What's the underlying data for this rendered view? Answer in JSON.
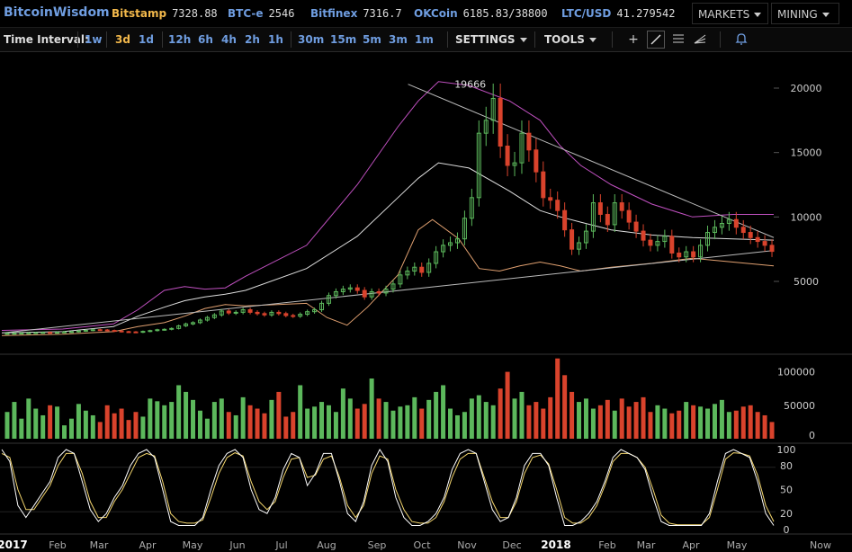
{
  "app": {
    "brand": "BitcoinWisdom"
  },
  "ticker": [
    {
      "exchange": "Bitstamp",
      "price": "7328.88",
      "selected": true
    },
    {
      "exchange": "BTC-e",
      "price": "2546",
      "selected": false
    },
    {
      "exchange": "Bitfinex",
      "price": "7316.7",
      "selected": false
    },
    {
      "exchange": "OKCoin",
      "price": "6185.83/38800",
      "selected": false
    },
    {
      "exchange": "LTC/USD",
      "price": "41.279542",
      "selected": false
    }
  ],
  "menus": {
    "markets": "MARKETS",
    "mining": "MINING"
  },
  "toolbar": {
    "time_interval_label": "Time Interval:",
    "intervals": [
      {
        "label": "1w",
        "selected": false
      },
      {
        "label": "3d",
        "selected": true
      },
      {
        "label": "1d",
        "selected": false
      },
      {
        "label": "12h",
        "selected": false
      },
      {
        "label": "6h",
        "selected": false
      },
      {
        "label": "4h",
        "selected": false
      },
      {
        "label": "2h",
        "selected": false
      },
      {
        "label": "1h",
        "selected": false
      },
      {
        "label": "30m",
        "selected": false
      },
      {
        "label": "15m",
        "selected": false
      },
      {
        "label": "5m",
        "selected": false
      },
      {
        "label": "3m",
        "selected": false
      },
      {
        "label": "1m",
        "selected": false
      }
    ],
    "settings": "SETTINGS",
    "tools": "TOOLS",
    "tool_icons": [
      "crosshair-icon",
      "trendline-icon",
      "horizontal-lines-icon",
      "fan-icon",
      "bell-icon"
    ]
  },
  "colors": {
    "up": "#5cb85c",
    "down": "#d9432c",
    "accent": "#6f9de0",
    "selected": "#f2b84b",
    "upper_band": "#c050c0",
    "lower_band": "#e0a070",
    "mid_band": "#dddddd"
  },
  "chart_data": {
    "type": "candlestick",
    "interval": "3d",
    "price_axis_ticks": [
      "20000",
      "15000",
      "10000",
      "5000"
    ],
    "volume_axis_ticks": [
      "100000",
      "50000",
      "0"
    ],
    "stoch_axis_ticks": [
      "100",
      "80",
      "50",
      "20",
      "0"
    ],
    "time_axis_labels": [
      "2017",
      "Feb",
      "Mar",
      "Apr",
      "May",
      "Jun",
      "Jul",
      "Aug",
      "Sep",
      "Oct",
      "Nov",
      "Dec",
      "2018",
      "Feb",
      "Mar",
      "Apr",
      "May",
      "Now"
    ],
    "peak_label": "19666",
    "close_series": [
      965,
      975,
      990,
      1000,
      1020,
      1040,
      1030,
      1050,
      1080,
      1100,
      1150,
      1200,
      1250,
      1230,
      1190,
      1150,
      1100,
      1080,
      1050,
      1120,
      1180,
      1250,
      1280,
      1350,
      1550,
      1700,
      1800,
      2000,
      2200,
      2400,
      2700,
      2550,
      2600,
      2800,
      2600,
      2500,
      2400,
      2600,
      2500,
      2350,
      2300,
      2450,
      2650,
      2800,
      3300,
      3900,
      4200,
      4400,
      4500,
      4300,
      3800,
      4200,
      4100,
      4400,
      4800,
      5500,
      5800,
      6100,
      5700,
      6400,
      7300,
      7800,
      8000,
      8300,
      9900,
      11500,
      16500,
      17500,
      19200,
      15500,
      14000,
      14200,
      16500,
      15200,
      13500,
      11500,
      11300,
      10500,
      9000,
      7500,
      8000,
      8900,
      11100,
      10200,
      9400,
      11100,
      10500,
      9600,
      8900,
      8200,
      7800,
      8100,
      8500,
      7200,
      6900,
      7300,
      6900,
      7800,
      8800,
      9200,
      9500,
      9800,
      9200,
      8800,
      8400,
      8100,
      7800,
      7330
    ],
    "upper_band_points": [
      [
        0,
        1200
      ],
      [
        30,
        1300
      ],
      [
        55,
        1700
      ],
      [
        67,
        2800
      ],
      [
        80,
        4300
      ],
      [
        90,
        4600
      ],
      [
        100,
        4400
      ],
      [
        110,
        4500
      ],
      [
        120,
        5400
      ],
      [
        150,
        7800
      ],
      [
        175,
        12500
      ],
      [
        195,
        17000
      ],
      [
        205,
        19000
      ],
      [
        215,
        20500
      ],
      [
        230,
        20200
      ],
      [
        250,
        19000
      ],
      [
        265,
        17500
      ],
      [
        275,
        15500
      ],
      [
        285,
        14000
      ],
      [
        300,
        12500
      ],
      [
        320,
        11000
      ],
      [
        340,
        10000
      ],
      [
        360,
        10200
      ],
      [
        380,
        10200
      ]
    ],
    "mid_band_points": [
      [
        0,
        1000
      ],
      [
        30,
        1100
      ],
      [
        55,
        1500
      ],
      [
        67,
        2300
      ],
      [
        80,
        3000
      ],
      [
        90,
        3500
      ],
      [
        100,
        3800
      ],
      [
        110,
        4000
      ],
      [
        120,
        4300
      ],
      [
        150,
        6000
      ],
      [
        175,
        8500
      ],
      [
        195,
        11500
      ],
      [
        205,
        13000
      ],
      [
        215,
        14200
      ],
      [
        230,
        13800
      ],
      [
        250,
        12000
      ],
      [
        265,
        10500
      ],
      [
        275,
        10000
      ],
      [
        285,
        9600
      ],
      [
        300,
        9000
      ],
      [
        320,
        8600
      ],
      [
        340,
        8400
      ],
      [
        360,
        8300
      ],
      [
        380,
        8200
      ]
    ],
    "lower_band_points": [
      [
        0,
        800
      ],
      [
        30,
        900
      ],
      [
        55,
        1100
      ],
      [
        67,
        1500
      ],
      [
        80,
        1800
      ],
      [
        90,
        2300
      ],
      [
        100,
        2900
      ],
      [
        110,
        3200
      ],
      [
        120,
        3100
      ],
      [
        150,
        3300
      ],
      [
        160,
        2200
      ],
      [
        170,
        1600
      ],
      [
        180,
        3000
      ],
      [
        195,
        5500
      ],
      [
        205,
        9000
      ],
      [
        212,
        9800
      ],
      [
        225,
        8300
      ],
      [
        235,
        6000
      ],
      [
        245,
        5800
      ],
      [
        255,
        6200
      ],
      [
        265,
        6500
      ],
      [
        275,
        6200
      ],
      [
        285,
        5800
      ],
      [
        300,
        6100
      ],
      [
        320,
        6400
      ],
      [
        340,
        6800
      ],
      [
        360,
        6500
      ],
      [
        380,
        6200
      ]
    ],
    "trend_lines": [
      {
        "from": [
          0,
          1000
        ],
        "to": [
          380,
          7400
        ]
      },
      {
        "from": [
          200,
          20300
        ],
        "to": [
          380,
          8400
        ]
      }
    ],
    "volume_series": [
      40000,
      55000,
      30000,
      60000,
      45000,
      35000,
      50000,
      48000,
      20000,
      30000,
      52000,
      42000,
      35000,
      25000,
      50000,
      38000,
      45000,
      28000,
      40000,
      33000,
      60000,
      56000,
      50000,
      55000,
      80000,
      70000,
      58000,
      42000,
      30000,
      55000,
      60000,
      40000,
      35000,
      62000,
      50000,
      45000,
      38000,
      58000,
      70000,
      33000,
      40000,
      80000,
      45000,
      48000,
      55000,
      50000,
      40000,
      75000,
      60000,
      45000,
      52000,
      90000,
      60000,
      55000,
      42000,
      48000,
      50000,
      62000,
      45000,
      58000,
      70000,
      80000,
      45000,
      35000,
      40000,
      60000,
      65000,
      55000,
      50000,
      75000,
      100000,
      60000,
      70000,
      50000,
      55000,
      45000,
      62000,
      120000,
      95000,
      70000,
      55000,
      60000,
      45000,
      50000,
      58000,
      42000,
      60000,
      48000,
      55000,
      62000,
      40000,
      50000,
      45000,
      38000,
      42000,
      55000,
      50000,
      48000,
      45000,
      52000,
      58000,
      40000,
      42000,
      48000,
      50000,
      40000,
      35000,
      25000
    ],
    "stoch_k": [
      100,
      85,
      30,
      15,
      30,
      45,
      60,
      90,
      100,
      95,
      60,
      25,
      10,
      20,
      40,
      55,
      80,
      95,
      100,
      90,
      50,
      10,
      5,
      5,
      5,
      15,
      50,
      80,
      95,
      100,
      90,
      50,
      25,
      20,
      40,
      75,
      95,
      90,
      55,
      70,
      95,
      95,
      60,
      20,
      10,
      35,
      80,
      100,
      85,
      40,
      15,
      5,
      5,
      10,
      20,
      40,
      75,
      95,
      100,
      95,
      60,
      25,
      10,
      15,
      40,
      80,
      95,
      95,
      80,
      40,
      5,
      5,
      10,
      20,
      35,
      60,
      90,
      100,
      95,
      90,
      75,
      40,
      10,
      5,
      5,
      5,
      5,
      5,
      20,
      60,
      95,
      100,
      95,
      90,
      60,
      20,
      5
    ],
    "stoch_d": [
      95,
      90,
      50,
      25,
      25,
      40,
      55,
      80,
      95,
      95,
      70,
      35,
      15,
      15,
      35,
      50,
      70,
      90,
      95,
      92,
      60,
      20,
      10,
      8,
      8,
      12,
      40,
      70,
      90,
      96,
      92,
      60,
      35,
      25,
      35,
      65,
      88,
      90,
      65,
      68,
      88,
      92,
      65,
      30,
      15,
      30,
      70,
      92,
      88,
      50,
      25,
      10,
      8,
      8,
      15,
      35,
      65,
      88,
      95,
      95,
      65,
      35,
      15,
      15,
      35,
      70,
      90,
      93,
      82,
      50,
      15,
      8,
      8,
      15,
      30,
      55,
      85,
      95,
      95,
      90,
      78,
      50,
      18,
      8,
      6,
      6,
      6,
      6,
      15,
      50,
      88,
      96,
      95,
      92,
      68,
      30,
      10
    ]
  }
}
